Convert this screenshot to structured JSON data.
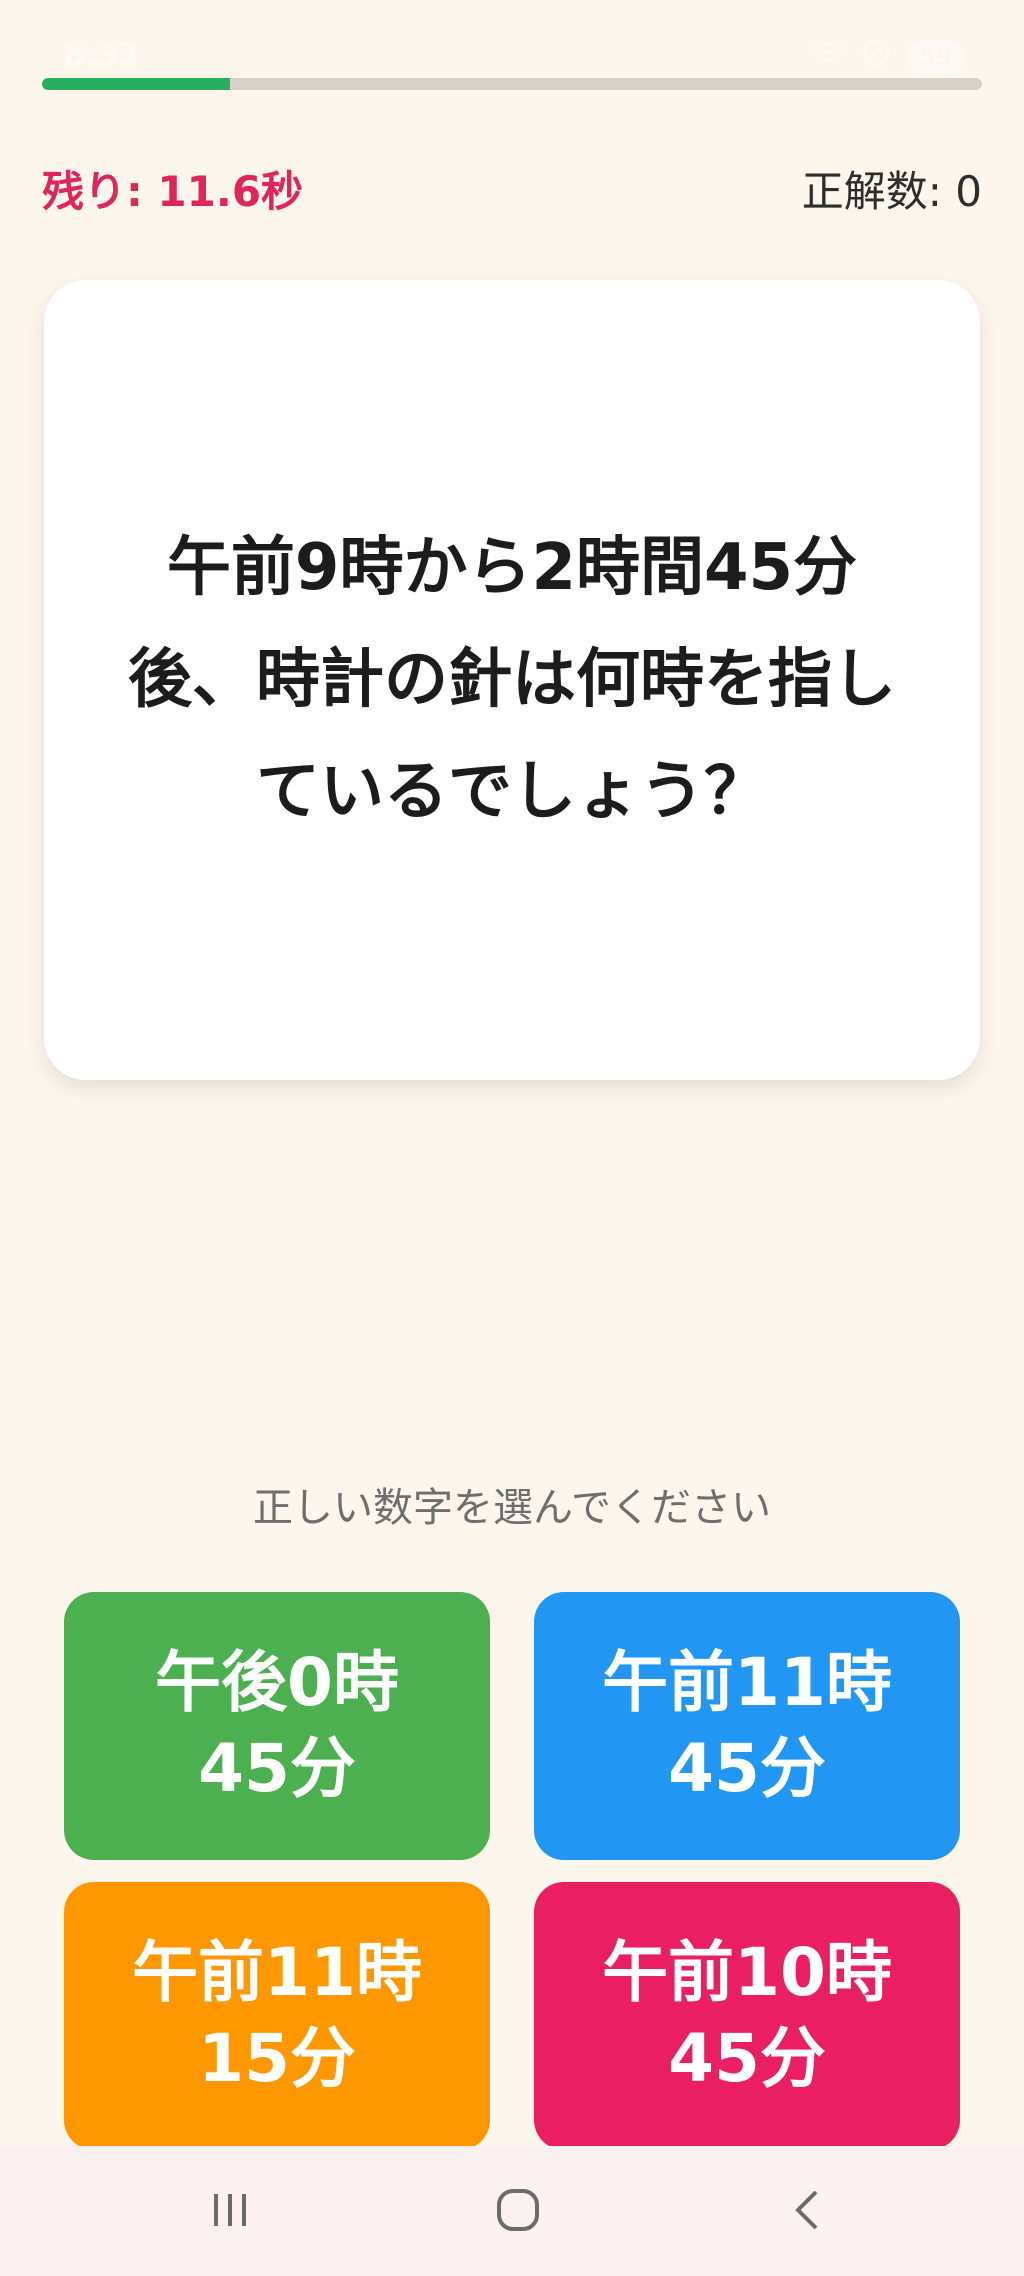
{
  "status_bar": {
    "time": "8:33",
    "battery": "59"
  },
  "progress": {
    "fraction": 0.2,
    "color": "#27ae60"
  },
  "timer": {
    "label": "残り: 11.6秒",
    "color": "#e0245e"
  },
  "score": {
    "label": "正解数: 0"
  },
  "question": {
    "text": "午前9時から2時間45分後、時計の針は何時を指しているでしょう？"
  },
  "instruction": "正しい数字を選んでください",
  "answers": [
    {
      "label": "午後0時45分",
      "color": "#4caf50"
    },
    {
      "label": "午前11時45分",
      "color": "#2196f3"
    },
    {
      "label": "午前11時15分",
      "color": "#ff9800"
    },
    {
      "label": "午前10時45分",
      "color": "#e91e63"
    }
  ],
  "nav_bar": {
    "icons": [
      "recent-apps-icon",
      "home-icon",
      "back-icon"
    ]
  }
}
